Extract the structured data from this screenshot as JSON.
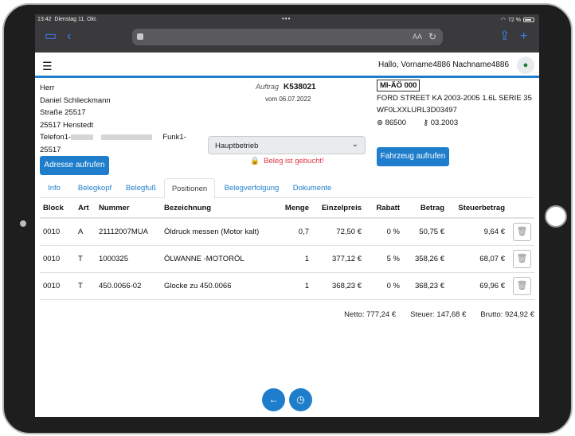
{
  "statusbar": {
    "time": "13:42",
    "date": "Dienstag 11. Okt.",
    "dots": "•••",
    "battery": "72 %"
  },
  "browser": {
    "text_size": "AA"
  },
  "header": {
    "greeting": "Hallo, Vorname4886 Nachname4886"
  },
  "customer": {
    "salutation": "Herr",
    "name": "Daniel Schlieckmann",
    "street": "Straße 25517",
    "city": "25517 Henstedt",
    "phone_label": "Telefon1-",
    "phone2_label": "Funk1-",
    "phone_suffix": "25517"
  },
  "order": {
    "label": "Auftrag",
    "number": "K538021",
    "date": "vom 06.07.2022"
  },
  "branch_select": {
    "value": "Hauptbetrieb"
  },
  "booked_status": "Beleg ist gebucht!",
  "buttons": {
    "address": "Adresse aufrufen",
    "vehicle": "Fahrzeug aufrufen"
  },
  "vehicle": {
    "plate": "MI-ÄÖ 000",
    "model": "FORD  STREET KA 2003-2005 1.6L  SERIE 35",
    "vin": "WF0LXXLURL3D03497",
    "mileage": "86500",
    "date": "03.2003"
  },
  "tabs": [
    "Info",
    "Belegkopf",
    "Belegfuß",
    "Positionen",
    "Belegverfolgung",
    "Dokumente"
  ],
  "table": {
    "headers": [
      "Block",
      "Art",
      "Nummer",
      "Bezeichnung",
      "Menge",
      "Einzelpreis",
      "Rabatt",
      "Betrag",
      "Steuerbetrag"
    ],
    "rows": [
      [
        "0010",
        "A",
        "21112007MUA",
        "Öldruck messen (Motor kalt)",
        "0,7",
        "72,50 €",
        "0 %",
        "50,75 €",
        "9,64 €"
      ],
      [
        "0010",
        "T",
        "1000325",
        "ÖLWANNE -MOTORÖL",
        "1",
        "377,12 €",
        "5 %",
        "358,26 €",
        "68,07 €"
      ],
      [
        "0010",
        "T",
        "450.0066-02",
        "Glocke zu 450.0066",
        "1",
        "368,23 €",
        "0 %",
        "368,23 €",
        "69,96 €"
      ]
    ]
  },
  "totals": {
    "net": "Netto: 777,24 €",
    "tax": "Steuer: 147,68 €",
    "gross": "Brutto: 924,92 €"
  },
  "colors": {
    "accent": "#1f7ecb",
    "danger": "#dc3545"
  }
}
